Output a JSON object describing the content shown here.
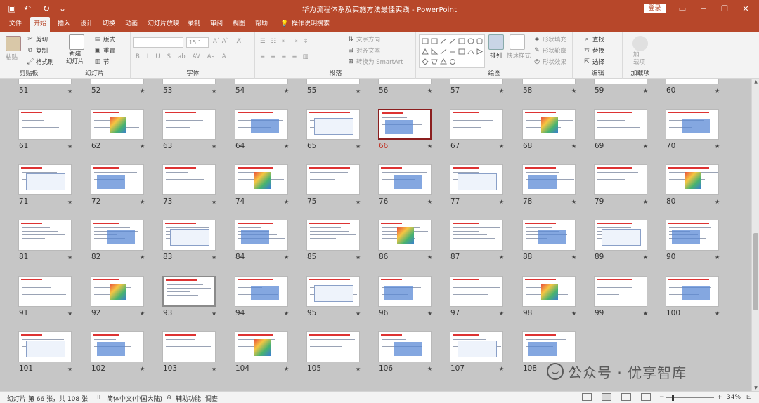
{
  "window": {
    "title": "华为流程体系及实施方法最佳实践  -  PowerPoint",
    "login_label": "登录",
    "controls": [
      "─",
      "❐",
      "□",
      "✕"
    ]
  },
  "tabs": [
    "文件",
    "开始",
    "插入",
    "设计",
    "切换",
    "动画",
    "幻灯片放映",
    "录制",
    "审阅",
    "视图",
    "帮助"
  ],
  "tell_me": "操作说明搜索",
  "ribbon": {
    "clipboard": {
      "label": "剪贴板",
      "paste": "粘贴",
      "cut": "剪切",
      "copy": "复制",
      "format_painter": "格式刷"
    },
    "slides": {
      "label": "幻灯片",
      "new_slide": "新建\n幻灯片",
      "layout": "版式",
      "reset": "重置",
      "section": "节"
    },
    "font": {
      "label": "字体",
      "size": "15.1"
    },
    "paragraph": {
      "label": "段落",
      "text_direction": "文字方向",
      "align_text": "对齐文本",
      "smartart": "转换为 SmartArt"
    },
    "drawing": {
      "label": "绘图",
      "arrange": "排列",
      "quick_styles": "快速样式",
      "fill": "形状填充",
      "outline": "形状轮廓",
      "effects": "形状效果"
    },
    "editing": {
      "label": "编辑",
      "find": "查找",
      "replace": "替换",
      "select": "选择"
    },
    "addins": {
      "label": "加载项",
      "addin": "加\n载项"
    }
  },
  "slides": [
    {
      "n": "51"
    },
    {
      "n": "52"
    },
    {
      "n": "53"
    },
    {
      "n": "54"
    },
    {
      "n": "55"
    },
    {
      "n": "56"
    },
    {
      "n": "57"
    },
    {
      "n": "58"
    },
    {
      "n": "59"
    },
    {
      "n": "60"
    },
    {
      "n": "61"
    },
    {
      "n": "62"
    },
    {
      "n": "63"
    },
    {
      "n": "64"
    },
    {
      "n": "65"
    },
    {
      "n": "66",
      "selected": true
    },
    {
      "n": "67"
    },
    {
      "n": "68"
    },
    {
      "n": "69"
    },
    {
      "n": "70"
    },
    {
      "n": "71"
    },
    {
      "n": "72"
    },
    {
      "n": "73"
    },
    {
      "n": "74"
    },
    {
      "n": "75"
    },
    {
      "n": "76"
    },
    {
      "n": "77"
    },
    {
      "n": "78"
    },
    {
      "n": "79"
    },
    {
      "n": "80"
    },
    {
      "n": "81"
    },
    {
      "n": "82"
    },
    {
      "n": "83"
    },
    {
      "n": "84"
    },
    {
      "n": "85"
    },
    {
      "n": "86"
    },
    {
      "n": "87"
    },
    {
      "n": "88"
    },
    {
      "n": "89"
    },
    {
      "n": "90"
    },
    {
      "n": "91"
    },
    {
      "n": "92"
    },
    {
      "n": "93"
    },
    {
      "n": "94"
    },
    {
      "n": "95"
    },
    {
      "n": "96"
    },
    {
      "n": "97"
    },
    {
      "n": "98"
    },
    {
      "n": "99"
    },
    {
      "n": "100"
    },
    {
      "n": "101"
    },
    {
      "n": "102"
    },
    {
      "n": "103"
    },
    {
      "n": "104"
    },
    {
      "n": "105"
    },
    {
      "n": "106"
    },
    {
      "n": "107"
    },
    {
      "n": "108"
    }
  ],
  "star_glyph": "★",
  "watermark": "公众号 · 优享智库",
  "status": {
    "slide_info": "幻灯片 第 66 张，共 108 张",
    "language": "简体中文(中国大陆)",
    "accessibility": "辅助功能: 调查",
    "zoom": "34%"
  },
  "colors": {
    "accent": "#b7472a",
    "selected_border": "#8b1e1e"
  }
}
